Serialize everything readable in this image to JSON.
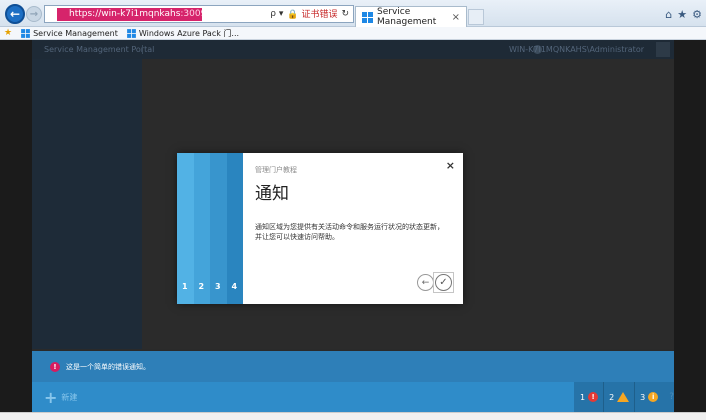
{
  "browser": {
    "url_host": "https://win-k7i1mqnkahs",
    "url_port": ":30091/",
    "address_actions": {
      "search_glyph": "ρ ▾",
      "cert_error": "证书错误",
      "refresh_glyph": "↻"
    },
    "tab_title": "Service Management",
    "tab_close": "×",
    "favorites": [
      "Service Management",
      "Windows Azure Pack 门..."
    ]
  },
  "portal": {
    "brand": "Service Management Portal",
    "user": "WIN-K7I1MQNKAHS\\Administrator"
  },
  "modal": {
    "subtitle": "管理门户教程",
    "title": "通知",
    "text": "通知区域为您提供有关活动命令和服务运行状况的状态更新，并让您可以快速访问帮助。",
    "close": "×",
    "steps": [
      "1",
      "2",
      "3",
      "4"
    ],
    "prev_glyph": "←",
    "ok_glyph": "✓"
  },
  "notification": {
    "icon_glyph": "!",
    "text": "这是一个简单的错误通知。"
  },
  "command_bar": {
    "new_label": "新建",
    "counters": {
      "error": "1",
      "warning": "2",
      "info": "3"
    }
  },
  "colors": {
    "accent": "#2f8cc9",
    "step1": "#52b2e5",
    "step4": "#2a85bf",
    "error": "#e53935",
    "warning": "#f5a623"
  }
}
